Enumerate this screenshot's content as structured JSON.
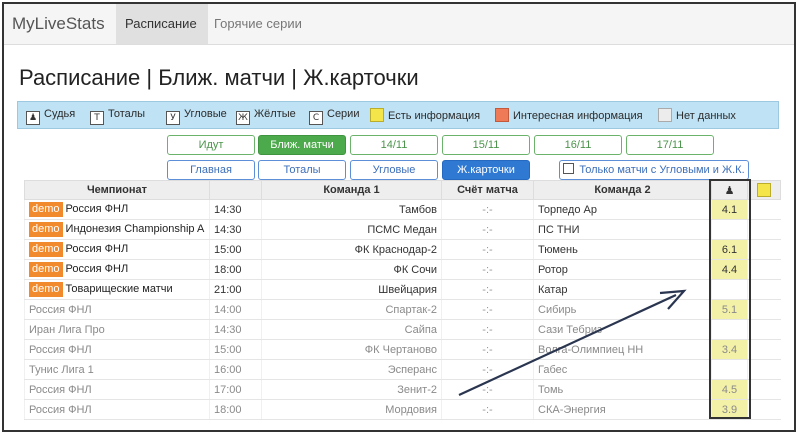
{
  "nav": {
    "brand": "MyLiveStats",
    "schedule": "Расписание",
    "hot": "Горячие серии"
  },
  "page_title": "Расписание | Ближ. матчи | Ж.карточки",
  "legend": {
    "items": [
      {
        "icon": "referee-icon",
        "glyph": "♟",
        "label": "Судья"
      },
      {
        "icon": "totals-icon",
        "glyph": "Т",
        "label": "Тоталы"
      },
      {
        "icon": "corners-icon",
        "glyph": "У",
        "label": "Угловые"
      },
      {
        "icon": "yellow-cards-icon",
        "glyph": "Ж",
        "label": "Жёлтые"
      },
      {
        "icon": "series-icon",
        "glyph": "С",
        "label": "Серии"
      },
      {
        "icon": "yellow-swatch",
        "glyph": "",
        "label": "Есть информация"
      },
      {
        "icon": "red-swatch",
        "glyph": "",
        "label": "Интересная информация"
      },
      {
        "icon": "grey-swatch",
        "glyph": "",
        "label": "Нет данных"
      }
    ],
    "colors": {
      "has_info": "#f4e54b",
      "interesting": "#ef7a57",
      "no_data": "#ececec"
    }
  },
  "date_tabs": [
    "Идут",
    "Ближ. матчи",
    "14/11",
    "15/11",
    "16/11",
    "17/11"
  ],
  "active_date_tab": "Ближ. матчи",
  "type_tabs": [
    "Главная",
    "Тоталы",
    "Угловые",
    "Ж.карточки"
  ],
  "active_type_tab": "Ж.карточки",
  "filter_label": "Только матчи с Угловыми и Ж.К.",
  "table": {
    "headers": {
      "champ": "Чемпионат",
      "time": "",
      "team1": "Команда 1",
      "score": "Счёт матча",
      "team2": "Команда 2",
      "ref": "♟",
      "yc": ""
    },
    "demo_label": "demo",
    "rows": [
      {
        "demo": true,
        "champ": "Россия ФНЛ",
        "time": "14:30",
        "team1": "Тамбов",
        "score": "-:-",
        "team2": "Торпедо Ар",
        "ref": "4.1"
      },
      {
        "demo": true,
        "champ": "Индонезия Championship A",
        "time": "14:30",
        "team1": "ПСМС Медан",
        "score": "-:-",
        "team2": "ПС ТНИ",
        "ref": ""
      },
      {
        "demo": true,
        "champ": "Россия ФНЛ",
        "time": "15:00",
        "team1": "ФК Краснодар-2",
        "score": "-:-",
        "team2": "Тюмень",
        "ref": "6.1"
      },
      {
        "demo": true,
        "champ": "Россия ФНЛ",
        "time": "18:00",
        "team1": "ФК Сочи",
        "score": "-:-",
        "team2": "Ротор",
        "ref": "4.4"
      },
      {
        "demo": true,
        "champ": "Товарищеские матчи",
        "time": "21:00",
        "team1": "Швейцария",
        "score": "-:-",
        "team2": "Катар",
        "ref": ""
      },
      {
        "demo": false,
        "champ": "Россия ФНЛ",
        "time": "14:00",
        "team1": "Спартак-2",
        "score": "-:-",
        "team2": "Сибирь",
        "ref": "5.1"
      },
      {
        "demo": false,
        "champ": "Иран Лига Про",
        "time": "14:30",
        "team1": "Сайпа",
        "score": "-:-",
        "team2": "Сази Тебриз",
        "ref": ""
      },
      {
        "demo": false,
        "champ": "Россия ФНЛ",
        "time": "15:00",
        "team1": "ФК Чертаново",
        "score": "-:-",
        "team2": "Волга-Олимпиец НН",
        "ref": "3.4"
      },
      {
        "demo": false,
        "champ": "Тунис Лига 1",
        "time": "16:00",
        "team1": "Эсперанс",
        "score": "-:-",
        "team2": "Габес",
        "ref": ""
      },
      {
        "demo": false,
        "champ": "Россия ФНЛ",
        "time": "17:00",
        "team1": "Зенит-2",
        "score": "-:-",
        "team2": "Томь",
        "ref": "4.5"
      },
      {
        "demo": false,
        "champ": "Россия ФНЛ",
        "time": "18:00",
        "team1": "Мордовия",
        "score": "-:-",
        "team2": "СКА-Энергия",
        "ref": "3.9"
      }
    ]
  }
}
